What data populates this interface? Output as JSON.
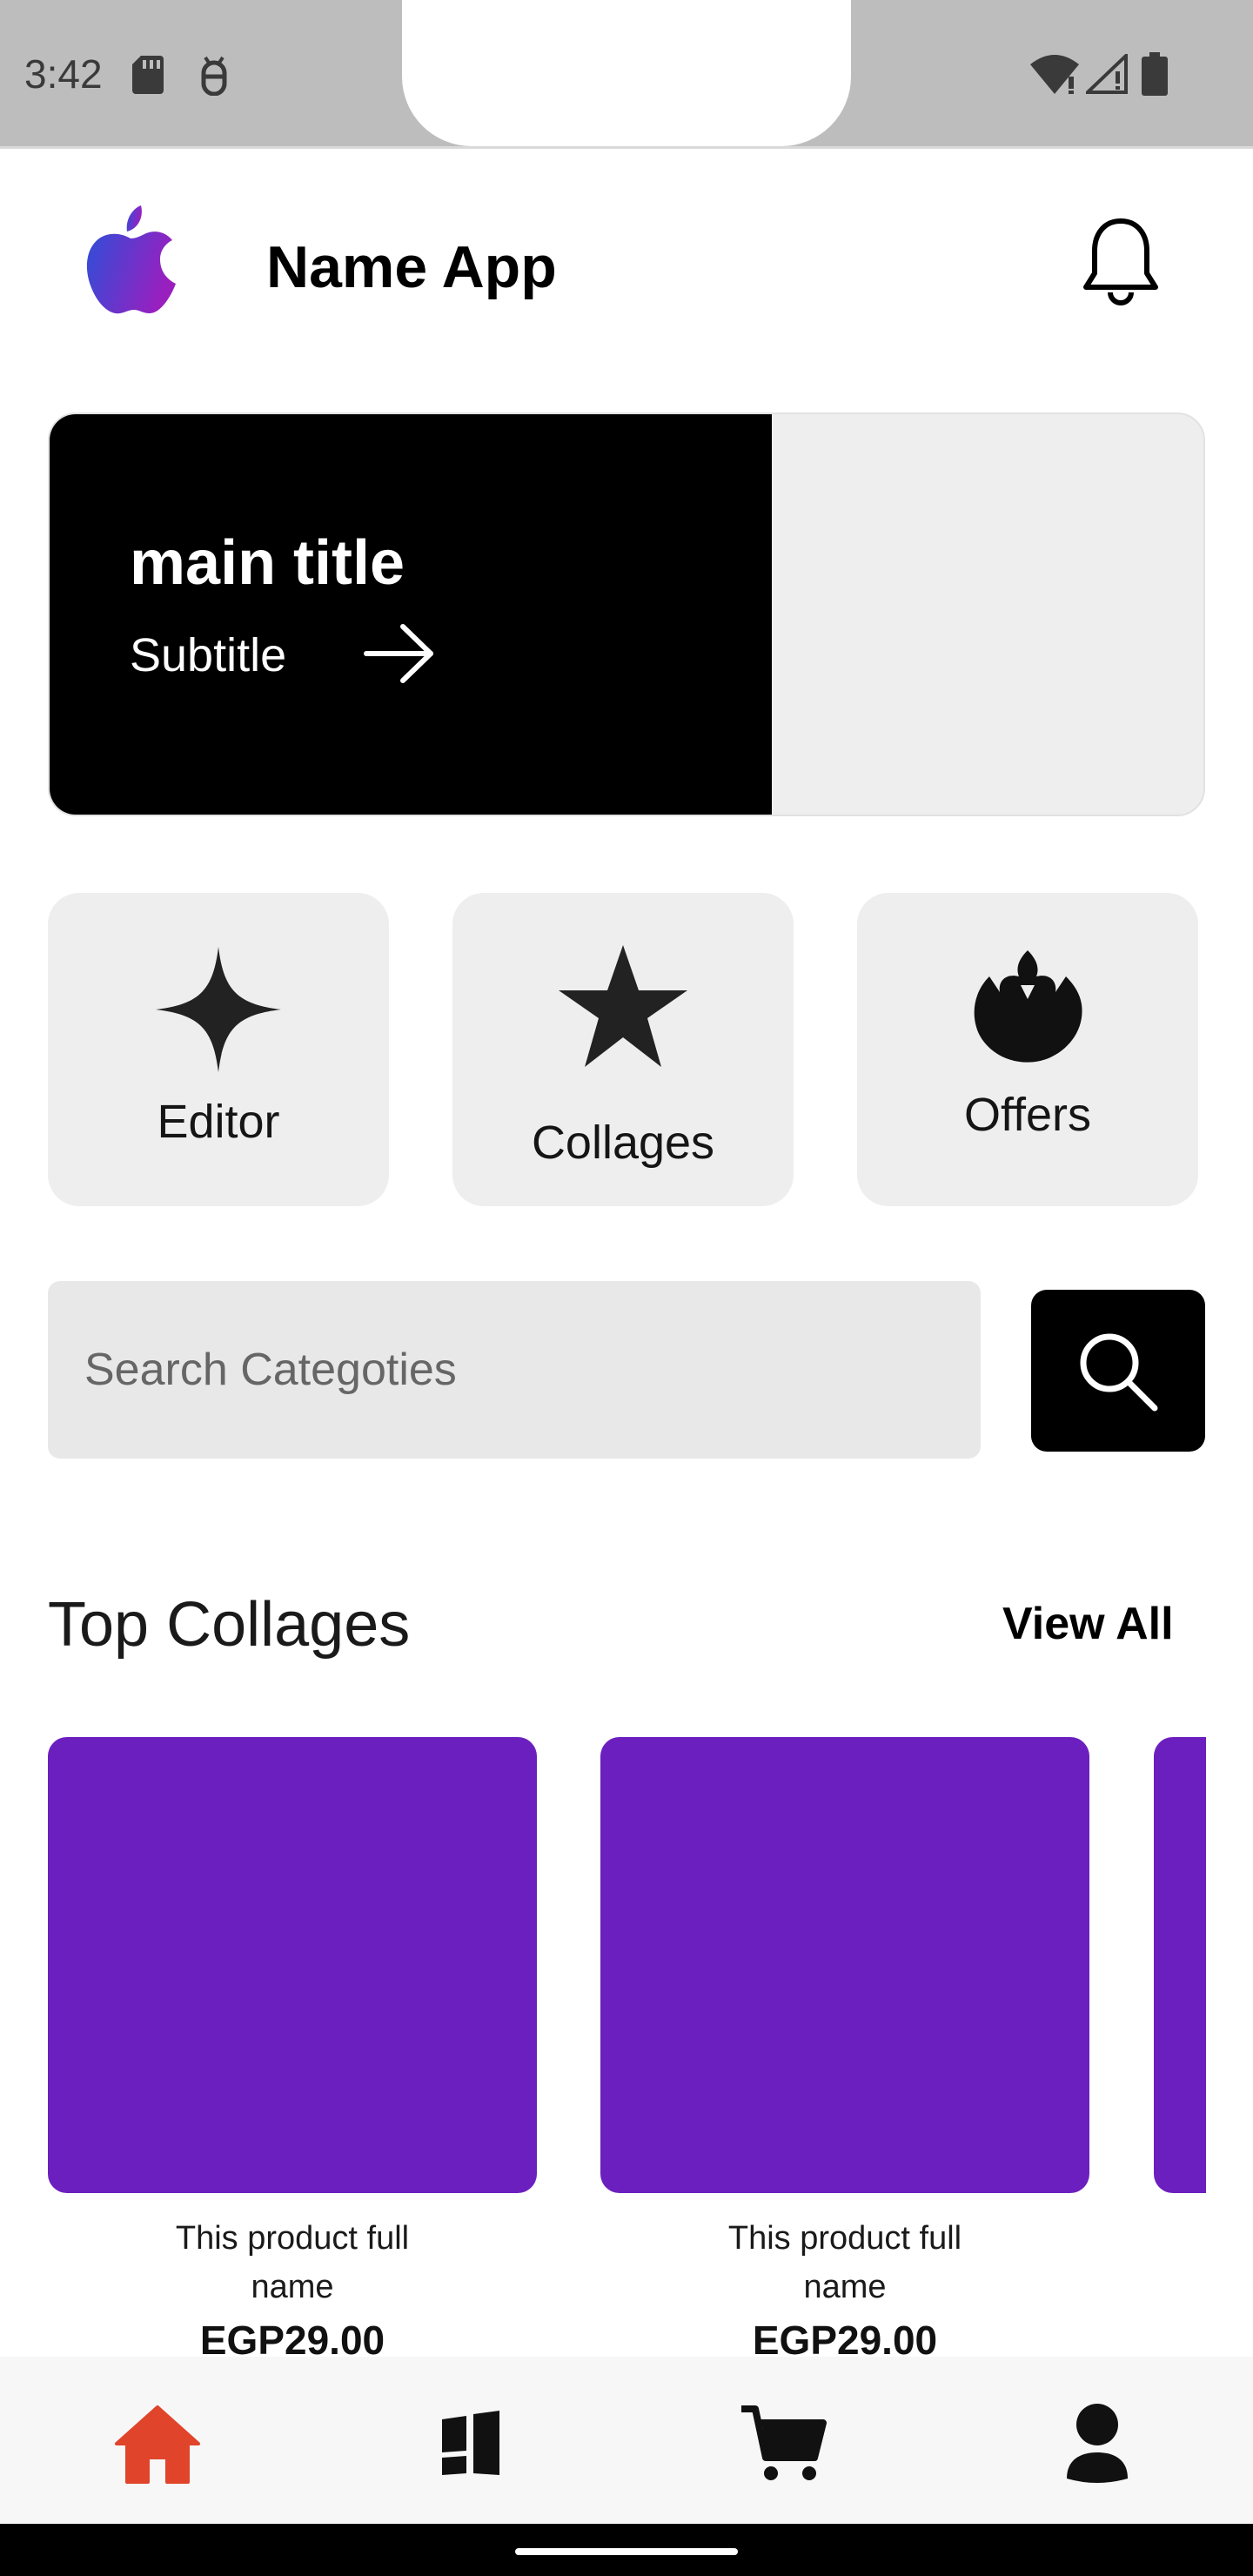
{
  "status_bar": {
    "time": "3:42",
    "icons": [
      "sd-card-icon",
      "android-debug-icon",
      "wifi-icon",
      "signal-icon",
      "battery-icon"
    ]
  },
  "header": {
    "app_name": "Name App",
    "logo_icon": "apple-logo-icon",
    "notification_icon": "bell-icon"
  },
  "banner": {
    "title": "main title",
    "subtitle": "Subtitle",
    "arrow_icon": "arrow-right-icon"
  },
  "categories": [
    {
      "label": "Editor",
      "icon": "sparkle-icon"
    },
    {
      "label": "Collages",
      "icon": "star-icon"
    },
    {
      "label": "Offers",
      "icon": "rebel-alliance-icon"
    }
  ],
  "search": {
    "placeholder": "Search Categoties",
    "value": "",
    "button_icon": "search-icon"
  },
  "top_collages": {
    "title": "Top Collages",
    "view_all_label": "View All",
    "products": [
      {
        "name": "This product full name",
        "price": "EGP29.00"
      },
      {
        "name": "This product full name",
        "price": "EGP29.00"
      }
    ]
  },
  "bottom_nav": [
    {
      "name": "home",
      "icon": "home-icon",
      "active": true
    },
    {
      "name": "collages",
      "icon": "collage-icon",
      "active": false
    },
    {
      "name": "cart",
      "icon": "cart-icon",
      "active": false
    },
    {
      "name": "profile",
      "icon": "user-icon",
      "active": false
    }
  ],
  "colors": {
    "accent_active": "#e0442b",
    "product_placeholder": "#6c1fbf",
    "banner_dark": "#000000",
    "tile_bg": "#eeeeee"
  }
}
